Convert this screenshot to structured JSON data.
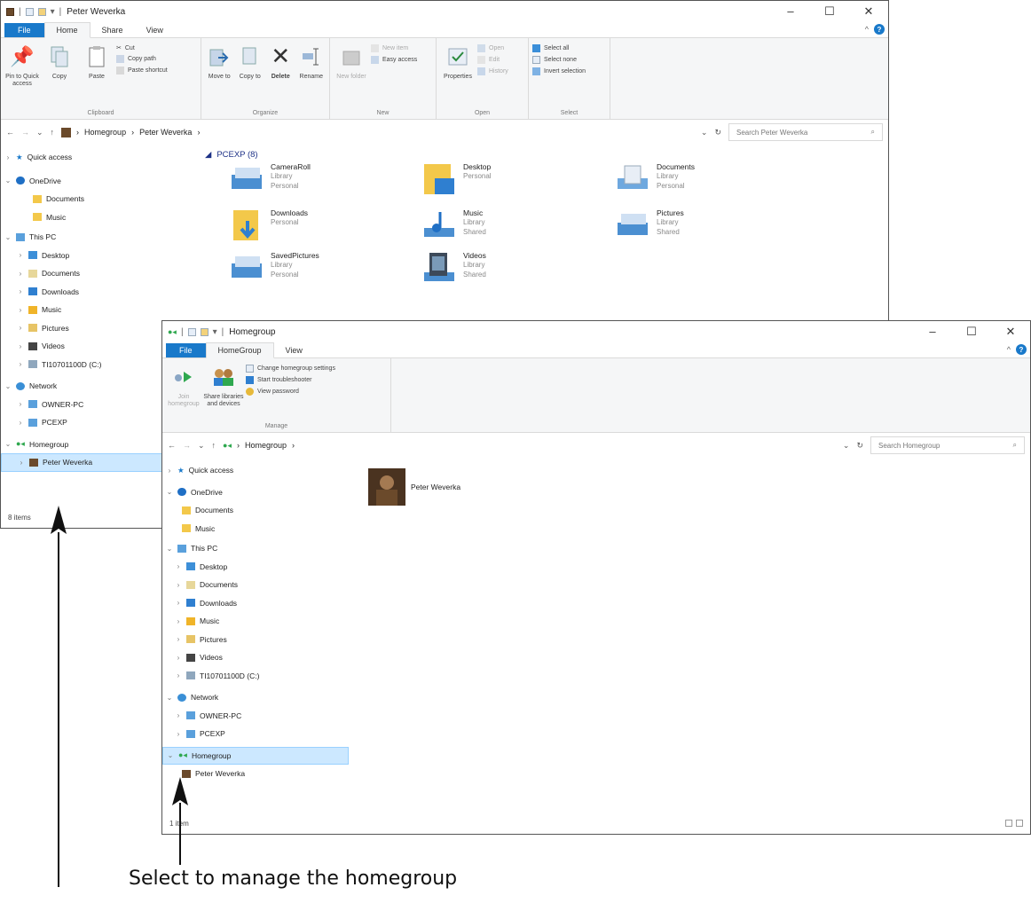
{
  "window1": {
    "title": "Peter Weverka",
    "controls": {
      "minimize": "–",
      "maximize": "☐",
      "close": "✕"
    },
    "tabs": [
      "File",
      "Home",
      "Share",
      "View"
    ],
    "ribbon": {
      "clipboard": {
        "label": "Clipboard",
        "pin": "Pin to Quick access",
        "copy": "Copy",
        "paste": "Paste",
        "cut": "Cut",
        "copy_path": "Copy path",
        "paste_shortcut": "Paste shortcut"
      },
      "organize": {
        "label": "Organize",
        "move_to": "Move to",
        "copy_to": "Copy to",
        "delete": "Delete",
        "rename": "Rename"
      },
      "new": {
        "label": "New",
        "new_folder": "New folder",
        "new_item": "New item",
        "easy_access": "Easy access"
      },
      "open": {
        "label": "Open",
        "properties": "Properties",
        "open": "Open",
        "edit": "Edit",
        "history": "History"
      },
      "select": {
        "label": "Select",
        "select_all": "Select all",
        "select_none": "Select none",
        "invert": "Invert selection"
      }
    },
    "breadcrumb": [
      "Homegroup",
      "Peter Weverka"
    ],
    "search_placeholder": "Search Peter Weverka",
    "nav": {
      "quick_access": "Quick access",
      "onedrive": "OneDrive",
      "documents": "Documents",
      "music": "Music",
      "this_pc": "This PC",
      "desktop": "Desktop",
      "documents2": "Documents",
      "downloads": "Downloads",
      "music2": "Music",
      "pictures": "Pictures",
      "videos": "Videos",
      "drive": "TI10701100D (C:)",
      "network": "Network",
      "owner_pc": "OWNER-PC",
      "pcexp": "PCEXP",
      "homegroup": "Homegroup",
      "peter": "Peter Weverka"
    },
    "group_header": "PCEXP (8)",
    "libraries": [
      {
        "name": "CameraRoll",
        "l1": "Library",
        "l2": "Personal"
      },
      {
        "name": "Desktop",
        "l1": "Personal",
        "l2": ""
      },
      {
        "name": "Documents",
        "l1": "Library",
        "l2": "Personal"
      },
      {
        "name": "Downloads",
        "l1": "Personal",
        "l2": ""
      },
      {
        "name": "Music",
        "l1": "Library",
        "l2": "Shared"
      },
      {
        "name": "Pictures",
        "l1": "Library",
        "l2": "Shared"
      },
      {
        "name": "SavedPictures",
        "l1": "Library",
        "l2": "Personal"
      },
      {
        "name": "Videos",
        "l1": "Library",
        "l2": "Shared"
      }
    ],
    "status": "8 items"
  },
  "window2": {
    "title": "Homegroup",
    "controls": {
      "minimize": "–",
      "maximize": "☐",
      "close": "✕"
    },
    "tabs": [
      "File",
      "HomeGroup",
      "View"
    ],
    "ribbon": {
      "label": "Manage",
      "join": "Join homegroup",
      "share": "Share libraries and devices",
      "change": "Change homegroup settings",
      "troubleshoot": "Start troubleshooter",
      "view_password": "View password"
    },
    "breadcrumb": [
      "Homegroup"
    ],
    "search_placeholder": "Search Homegroup",
    "nav": {
      "quick_access": "Quick access",
      "onedrive": "OneDrive",
      "documents": "Documents",
      "music": "Music",
      "this_pc": "This PC",
      "desktop": "Desktop",
      "documents2": "Documents",
      "downloads": "Downloads",
      "music2": "Music",
      "pictures": "Pictures",
      "videos": "Videos",
      "drive": "TI10701100D (C:)",
      "network": "Network",
      "owner_pc": "OWNER-PC",
      "pcexp": "PCEXP",
      "homegroup": "Homegroup",
      "peter": "Peter Weverka"
    },
    "member": "Peter Weverka",
    "status": "1 item"
  },
  "caption": "Select to manage the homegroup",
  "colors": {
    "accent": "#1979ca",
    "selection": "#cce8ff",
    "folder": "#f3c84a",
    "homegroup": "#2fa84f"
  }
}
